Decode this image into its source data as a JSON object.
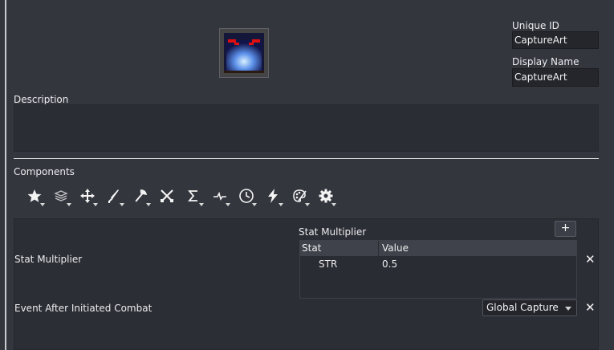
{
  "identity": {
    "unique_id_label": "Unique ID",
    "unique_id_value": "CaptureArt",
    "display_name_label": "Display Name",
    "display_name_value": "CaptureArt"
  },
  "description": {
    "label": "Description",
    "value": ""
  },
  "components": {
    "label": "Components",
    "toolbar": [
      {
        "icon": "star-icon"
      },
      {
        "icon": "layers-icon"
      },
      {
        "icon": "move-arrows-icon"
      },
      {
        "icon": "sword-icon"
      },
      {
        "icon": "axe-icon"
      },
      {
        "icon": "crossed-swords-icon"
      },
      {
        "icon": "sigma-icon"
      },
      {
        "icon": "pulse-icon"
      },
      {
        "icon": "clock-icon"
      },
      {
        "icon": "lightning-icon"
      },
      {
        "icon": "palette-icon"
      },
      {
        "icon": "gear-icon"
      }
    ],
    "stat_multiplier": {
      "row_label": "Stat Multiplier",
      "table_title": "Stat Multiplier",
      "add_label": "+",
      "columns": [
        "Stat",
        "Value"
      ],
      "rows": [
        {
          "stat": "STR",
          "value": "0.5"
        }
      ],
      "remove_label": "✕"
    },
    "event_after": {
      "row_label": "Event After Initiated Combat",
      "selected": "Global Capture",
      "remove_label": "✕"
    }
  }
}
